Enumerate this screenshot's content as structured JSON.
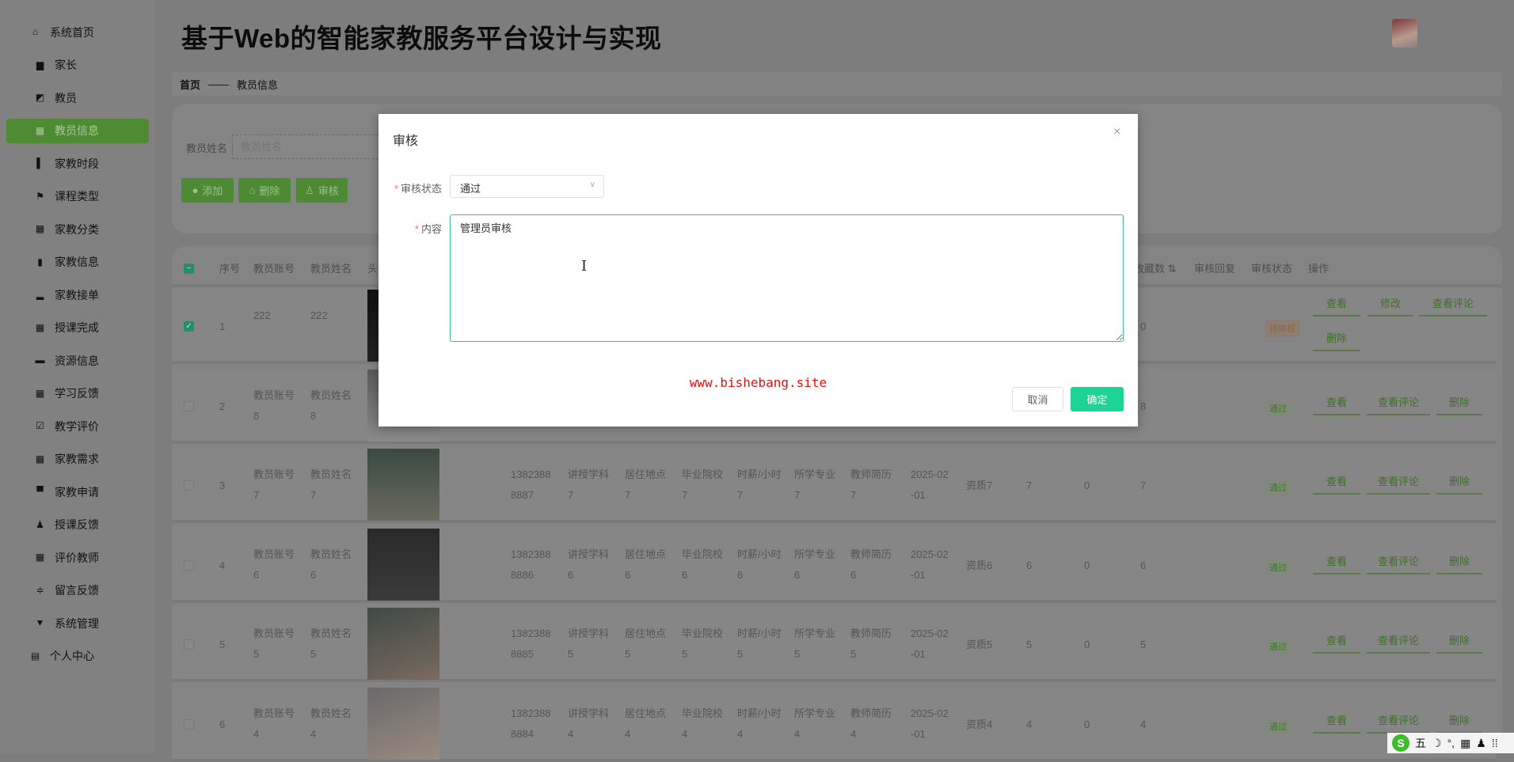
{
  "app_title": "基于Web的智能家教服务平台设计与实现",
  "sidebar": {
    "items": [
      {
        "label": "系统首页",
        "icon": "home-icon",
        "glyph": "⌂",
        "plain": true
      },
      {
        "label": "家长",
        "icon": "monitor-icon",
        "glyph": "▆"
      },
      {
        "label": "教员",
        "icon": "chart-box-icon",
        "glyph": "◩"
      },
      {
        "label": "教员信息",
        "icon": "grid-icon",
        "glyph": "▦",
        "active": true
      },
      {
        "label": "家教时段",
        "icon": "book-icon",
        "glyph": "▌"
      },
      {
        "label": "课程类型",
        "icon": "flag-icon",
        "glyph": "⚑"
      },
      {
        "label": "家教分类",
        "icon": "grid-icon",
        "glyph": "▦"
      },
      {
        "label": "家教信息",
        "icon": "clipboard-icon",
        "glyph": "▮"
      },
      {
        "label": "家教接单",
        "icon": "bar-chart-icon",
        "glyph": "▂"
      },
      {
        "label": "授课完成",
        "icon": "grid-icon",
        "glyph": "▦"
      },
      {
        "label": "资源信息",
        "icon": "briefcase-icon",
        "glyph": "▬"
      },
      {
        "label": "学习反馈",
        "icon": "grid-icon",
        "glyph": "▦"
      },
      {
        "label": "教学评价",
        "icon": "clipboard-check-icon",
        "glyph": "☑"
      },
      {
        "label": "家教需求",
        "icon": "grid-icon",
        "glyph": "▦"
      },
      {
        "label": "家教申请",
        "icon": "inbox-icon",
        "glyph": "▀"
      },
      {
        "label": "授课反馈",
        "icon": "user-icon",
        "glyph": "♟"
      },
      {
        "label": "评价教师",
        "icon": "grid-icon",
        "glyph": "▦"
      },
      {
        "label": "留言反馈",
        "icon": "sliders-icon",
        "glyph": "≑"
      },
      {
        "label": "系统管理",
        "icon": "pushpin-icon",
        "glyph": "▼"
      },
      {
        "label": "个人中心",
        "icon": "calendar-icon",
        "glyph": "▤",
        "plain": true
      }
    ]
  },
  "breadcrumb": {
    "home": "首页",
    "separator": "——",
    "current": "教员信息"
  },
  "search": {
    "label": "教员姓名",
    "placeholder": "教员姓名"
  },
  "toolbar": {
    "add": "添加",
    "delete": "删除",
    "audit": "审核"
  },
  "table": {
    "headers": {
      "index": "序号",
      "account": "教员账号",
      "name": "教员姓名",
      "photo": "头",
      "collect": "收藏数 ⇅",
      "reply": "审核回复",
      "status": "审核状态",
      "ops": "操作"
    },
    "rows": [
      {
        "checked": true,
        "index": "1",
        "account": "222",
        "name": "222",
        "phone": "",
        "subject": "",
        "address": "",
        "school": "",
        "wage": "",
        "major": "",
        "resume": "",
        "date": "",
        "qual": "",
        "n1": "",
        "n2": "",
        "n3": "0",
        "status": "待审核",
        "actions": [
          "查看",
          "修改",
          "查看评论",
          "删除"
        ]
      },
      {
        "checked": false,
        "index": "2",
        "account": "教员账号8",
        "name": "教员姓名8",
        "phone": "",
        "subject": "",
        "address": "",
        "school": "",
        "wage": "",
        "major": "",
        "resume": "",
        "date": "",
        "qual": "",
        "n1": "",
        "n2": "",
        "n3": "8",
        "status": "通过",
        "actions": [
          "查看",
          "查看评论",
          "删除"
        ]
      },
      {
        "checked": false,
        "index": "3",
        "account": "教员账号7",
        "name": "教员姓名7",
        "phone": "13823888887",
        "subject": "讲授学科7",
        "address": "居住地点7",
        "school": "毕业院校7",
        "wage": "时薪/小时7",
        "major": "所学专业7",
        "resume": "教师简历7",
        "date": "2025-02-01",
        "qual": "资质7",
        "n1": "7",
        "n2": "0",
        "n3": "7",
        "status": "通过",
        "actions": [
          "查看",
          "查看评论",
          "删除"
        ]
      },
      {
        "checked": false,
        "index": "4",
        "account": "教员账号6",
        "name": "教员姓名6",
        "phone": "13823888886",
        "subject": "讲授学科6",
        "address": "居住地点6",
        "school": "毕业院校6",
        "wage": "时薪/小时6",
        "major": "所学专业6",
        "resume": "教师简历6",
        "date": "2025-02-01",
        "qual": "资质6",
        "n1": "6",
        "n2": "0",
        "n3": "6",
        "status": "通过",
        "actions": [
          "查看",
          "查看评论",
          "删除"
        ]
      },
      {
        "checked": false,
        "index": "5",
        "account": "教员账号5",
        "name": "教员姓名5",
        "phone": "13823888885",
        "subject": "讲授学科5",
        "address": "居住地点5",
        "school": "毕业院校5",
        "wage": "时薪/小时5",
        "major": "所学专业5",
        "resume": "教师简历5",
        "date": "2025-02-01",
        "qual": "资质5",
        "n1": "5",
        "n2": "0",
        "n3": "5",
        "status": "通过",
        "actions": [
          "查看",
          "查看评论",
          "删除"
        ]
      },
      {
        "checked": false,
        "index": "6",
        "account": "教员账号4",
        "name": "教员姓名4",
        "phone": "13823888884",
        "subject": "讲授学科4",
        "address": "居住地点4",
        "school": "毕业院校4",
        "wage": "时薪/小时4",
        "major": "所学专业4",
        "resume": "教师简历4",
        "date": "2025-02-01",
        "qual": "资质4",
        "n1": "4",
        "n2": "0",
        "n3": "4",
        "status": "通过",
        "actions": [
          "查看",
          "查看评论",
          "删除"
        ]
      }
    ]
  },
  "dialog": {
    "title": "审核",
    "close": "×",
    "status_label": "审核状态",
    "status_value": "通过",
    "content_label": "内容",
    "content_value": "管理员审核",
    "watermark": "www.bishebang.site",
    "cancel": "取消",
    "confirm": "确定"
  },
  "ime": {
    "mode": "五",
    "items": [
      "☽",
      "°,",
      "▦",
      "♟",
      "⁞⁞"
    ]
  },
  "colors": {
    "accent": "#4e8b33",
    "confirm": "#1ed495",
    "pending": "#a06020",
    "passed": "#3d7a22"
  }
}
